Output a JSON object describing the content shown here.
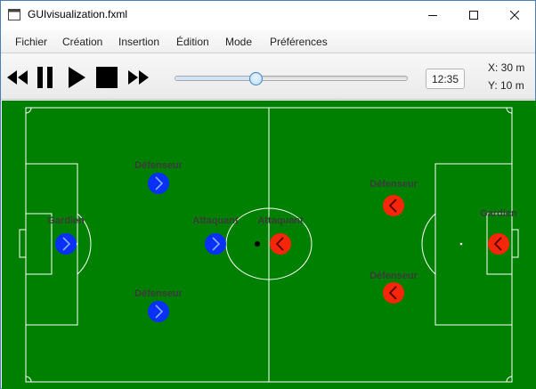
{
  "window": {
    "title": "GUIvisualization.fxml"
  },
  "menu": {
    "items": [
      {
        "label": "Fichier"
      },
      {
        "label": "Création"
      },
      {
        "label": "Insertion"
      },
      {
        "label": "Édition"
      },
      {
        "label": "Mode"
      },
      {
        "label": "Préférences"
      }
    ]
  },
  "toolbar": {
    "buttons": [
      "rewind-icon",
      "pause-icon",
      "play-icon",
      "stop-icon",
      "fast-forward-icon"
    ],
    "slider": {
      "value_fraction": 0.35
    },
    "time": "12:35",
    "coord_x": "X: 30 m",
    "coord_y": "Y: 10 m"
  },
  "field": {
    "grass_color": "#008000",
    "line_color": "#ffffff",
    "team_blue_color": "#0a2ff5",
    "team_red_color": "#f5260a",
    "ball_color": "#000000",
    "blue_players": [
      {
        "label": "Gardien"
      },
      {
        "label": "Défenseur"
      },
      {
        "label": "Défenseur"
      },
      {
        "label": "Attaquant"
      }
    ],
    "red_players": [
      {
        "label": "Attaquant"
      },
      {
        "label": "Défenseur"
      },
      {
        "label": "Défenseur"
      },
      {
        "label": "Gardien"
      }
    ]
  }
}
